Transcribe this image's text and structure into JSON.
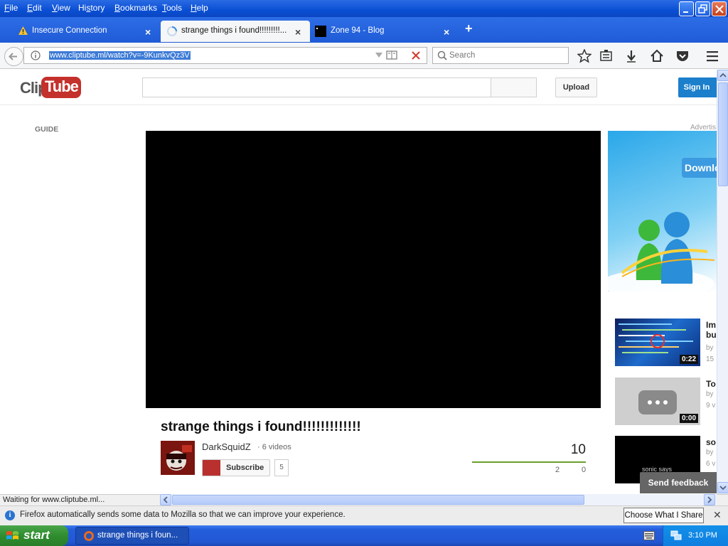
{
  "menubar": {
    "items": [
      {
        "pre": "",
        "u": "F",
        "post": "ile"
      },
      {
        "pre": "",
        "u": "E",
        "post": "dit"
      },
      {
        "pre": "",
        "u": "V",
        "post": "iew"
      },
      {
        "pre": "Hi",
        "u": "s",
        "post": "tory"
      },
      {
        "pre": "",
        "u": "B",
        "post": "ookmarks"
      },
      {
        "pre": "",
        "u": "T",
        "post": "ools"
      },
      {
        "pre": "",
        "u": "H",
        "post": "elp"
      }
    ]
  },
  "tabs": [
    {
      "label": "Insecure Connection"
    },
    {
      "label": "strange things i found!!!!!!!!!..."
    },
    {
      "label": "Zone 94 - Blog"
    }
  ],
  "navbar": {
    "url": "www.cliptube.ml/watch?v=-9KunkvQz3V",
    "search_placeholder": "Search"
  },
  "site": {
    "logo_clip": "Clip",
    "logo_tube": "Tube",
    "upload_label": "Upload",
    "signin_label": "Sign In",
    "guide_label": "GUIDE",
    "advert_label": "Advertis"
  },
  "video": {
    "title": "strange things i found!!!!!!!!!!!!!",
    "owner": "DarkSquidZ",
    "video_count": "· 6 videos",
    "subscribe_label": "Subscribe",
    "subscriber_count": "5",
    "views": "10",
    "likes": "2",
    "dislikes": "0",
    "like_ratio": 1.0
  },
  "ad": {
    "download_label": "Downlo"
  },
  "related": [
    {
      "title": "Im",
      "title2": "bu",
      "by": "by",
      "views": "15",
      "duration": "0:22"
    },
    {
      "title": "To",
      "by": "by",
      "views": "9 v",
      "duration": "0:00"
    },
    {
      "title": "so",
      "by": "by",
      "views": "6 v",
      "thumb_text": "sonic says"
    }
  ],
  "feedback_label": "Send feedback",
  "status": {
    "text": "Waiting for www.cliptube.ml..."
  },
  "notification": {
    "message": "Firefox automatically sends some data to Mozilla so that we can improve your experience.",
    "button_label": "Choose What I Share"
  },
  "taskbar": {
    "start_label": "start",
    "task_label": "strange things i foun...",
    "clock": "3:10 PM"
  },
  "colors": {
    "brand_red": "#c4302b",
    "signin_blue": "#1b7fcc",
    "xp_blue": "#245edb",
    "like_green": "#6b9f2b"
  }
}
